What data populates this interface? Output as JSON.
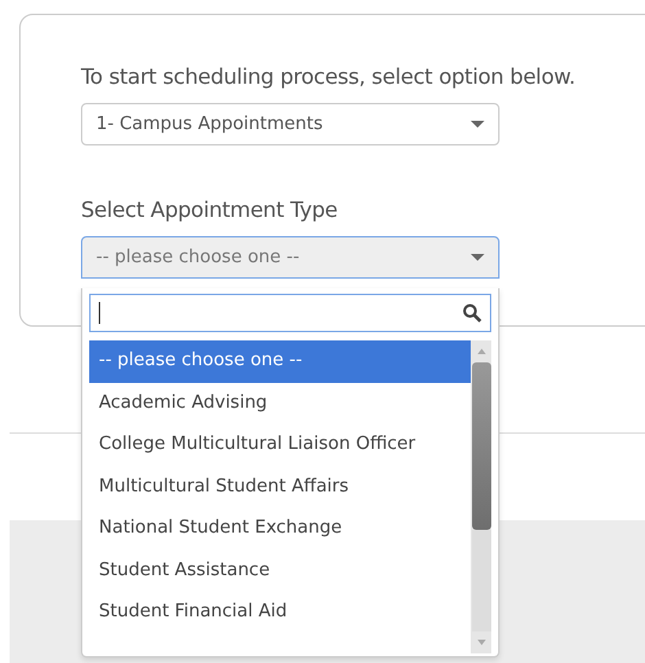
{
  "prompt": "To start scheduling process, select option below.",
  "campus_select": {
    "value": "1- Campus Appointments"
  },
  "type_label": "Select Appointment Type",
  "type_select": {
    "value": "-- please choose one --",
    "expanded": true
  },
  "options": [
    {
      "label": "-- please choose one --",
      "selected": true
    },
    {
      "label": "Academic Advising",
      "selected": false
    },
    {
      "label": "College Multicultural Liaison Officer",
      "selected": false
    },
    {
      "label": "Multicultural Student Affairs",
      "selected": false
    },
    {
      "label": "National Student Exchange",
      "selected": false
    },
    {
      "label": "Student Assistance",
      "selected": false
    },
    {
      "label": "Student Financial Aid",
      "selected": false
    }
  ]
}
